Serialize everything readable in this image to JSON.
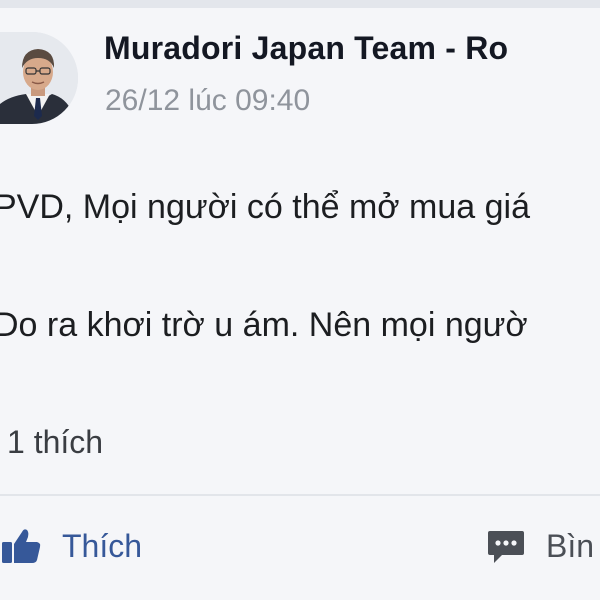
{
  "post": {
    "author": "Muradori Japan Team - Ro",
    "timestamp": "26/12 lúc 09:40",
    "body_lines": [
      "PVD, Mọi người có thể mở mua giá",
      "Do ra khơi trờ u ám. Nên mọi ngườ"
    ],
    "reaction_count": "1 thích"
  },
  "actions": {
    "like_label": "Thích",
    "comment_label": "Bìn"
  },
  "colors": {
    "like_blue": "#365899",
    "icon_gray": "#4b4f56",
    "background": "#f5f6f9"
  }
}
